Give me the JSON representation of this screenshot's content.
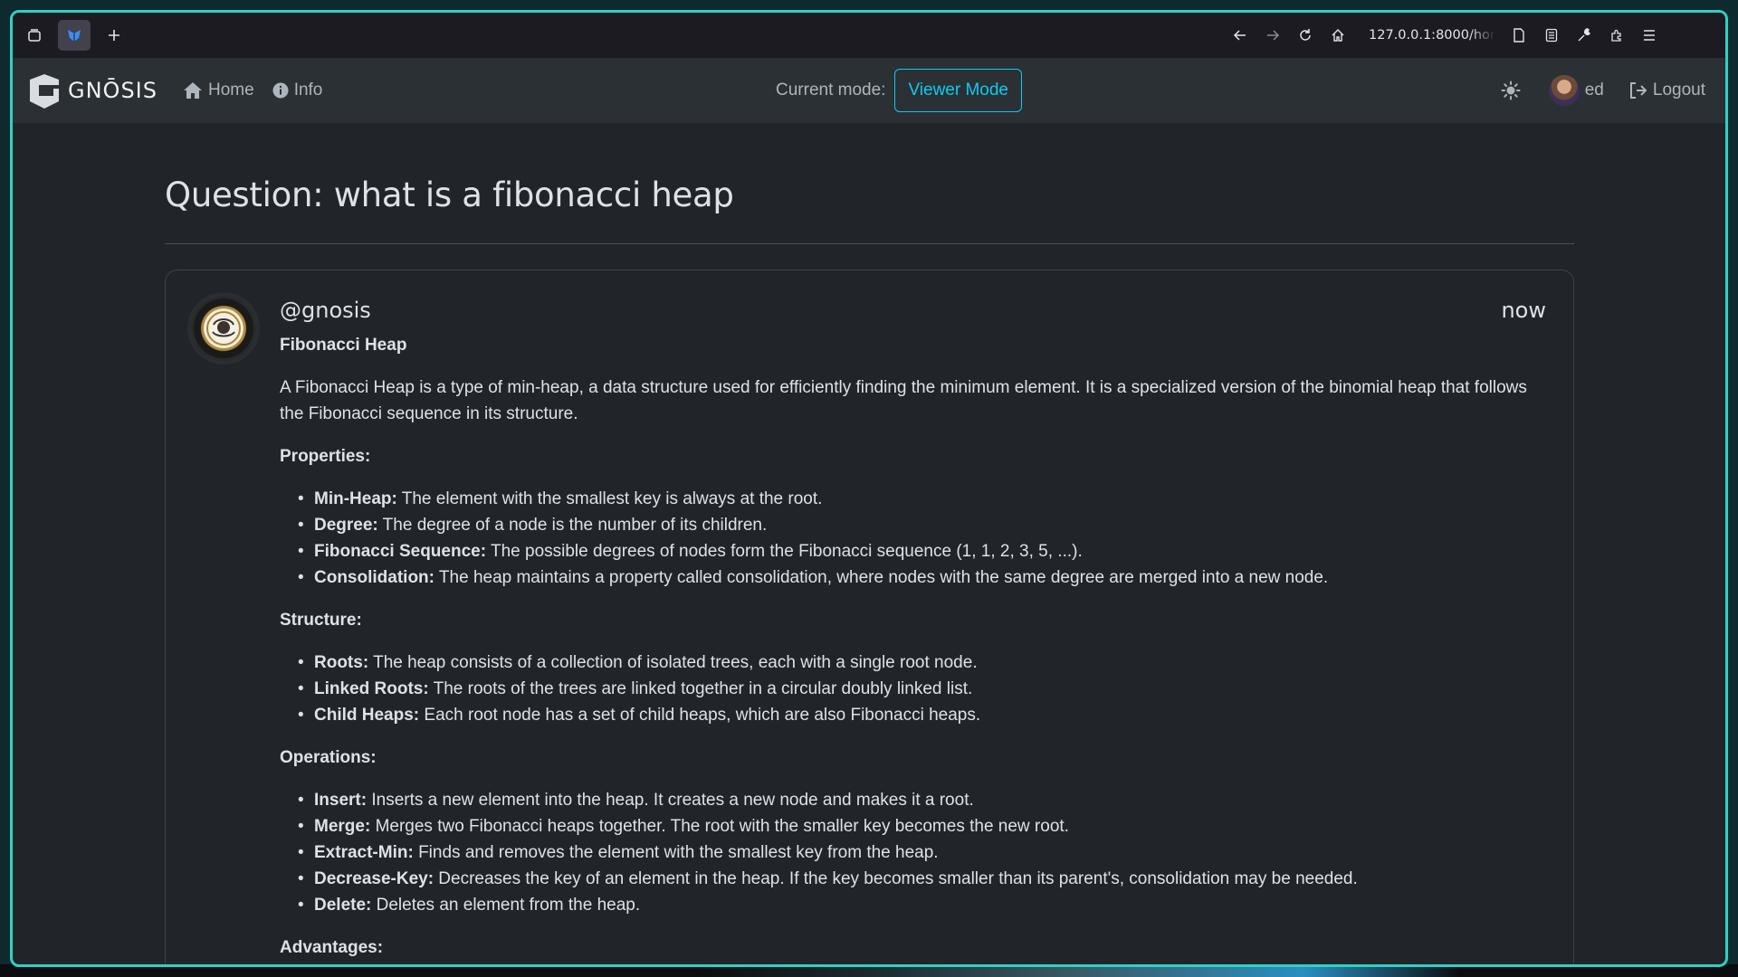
{
  "browser": {
    "url": "127.0.0.1:8000/home"
  },
  "navbar": {
    "brand": "GNŌSIS",
    "links": [
      {
        "label": "Home",
        "icon": "home-icon"
      },
      {
        "label": "Info",
        "icon": "info-icon"
      }
    ],
    "mode_label": "Current mode:",
    "mode_value": "Viewer Mode",
    "user_name": "ed",
    "logout_label": "Logout"
  },
  "page": {
    "title": "Question: what is a fibonacci heap"
  },
  "answer": {
    "handle": "@gnosis",
    "time": "now",
    "heading": "Fibonacci Heap",
    "intro": "A Fibonacci Heap is a type of min-heap, a data structure used for efficiently finding the minimum element. It is a specialized version of the binomial heap that follows the Fibonacci sequence in its structure.",
    "sections": [
      {
        "title": "Properties:",
        "items": [
          {
            "term": "Min-Heap:",
            "text": " The element with the smallest key is always at the root."
          },
          {
            "term": "Degree:",
            "text": " The degree of a node is the number of its children."
          },
          {
            "term": "Fibonacci Sequence:",
            "text": " The possible degrees of nodes form the Fibonacci sequence (1, 1, 2, 3, 5, ...)."
          },
          {
            "term": "Consolidation:",
            "text": " The heap maintains a property called consolidation, where nodes with the same degree are merged into a new node."
          }
        ]
      },
      {
        "title": "Structure:",
        "items": [
          {
            "term": "Roots:",
            "text": " The heap consists of a collection of isolated trees, each with a single root node."
          },
          {
            "term": "Linked Roots:",
            "text": " The roots of the trees are linked together in a circular doubly linked list."
          },
          {
            "term": "Child Heaps:",
            "text": " Each root node has a set of child heaps, which are also Fibonacci heaps."
          }
        ]
      },
      {
        "title": "Operations:",
        "items": [
          {
            "term": "Insert:",
            "text": " Inserts a new element into the heap. It creates a new node and makes it a root."
          },
          {
            "term": "Merge:",
            "text": " Merges two Fibonacci heaps together. The root with the smaller key becomes the new root."
          },
          {
            "term": "Extract-Min:",
            "text": " Finds and removes the element with the smallest key from the heap."
          },
          {
            "term": "Decrease-Key:",
            "text": " Decreases the key of an element in the heap. If the key becomes smaller than its parent's, consolidation may be needed."
          },
          {
            "term": "Delete:",
            "text": " Deletes an element from the heap."
          }
        ]
      },
      {
        "title": "Advantages:",
        "items": []
      }
    ]
  },
  "colors": {
    "accent": "#0dcaf0",
    "window_border": "#2fd1c6",
    "background": "#212529",
    "navbar": "#2b3035"
  }
}
